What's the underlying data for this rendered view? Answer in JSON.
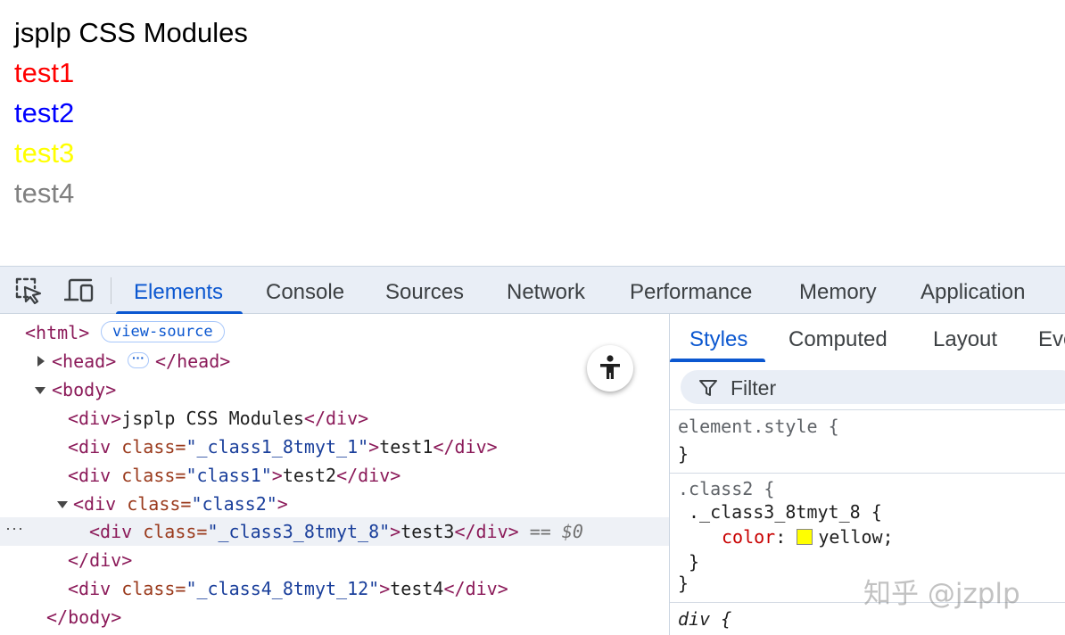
{
  "preview": {
    "lines": [
      {
        "text": "jsplp CSS Modules",
        "color": "#000000"
      },
      {
        "text": "test1",
        "color": "#ff0000"
      },
      {
        "text": "test2",
        "color": "#0000ff"
      },
      {
        "text": "test3",
        "color": "#ffff00"
      },
      {
        "text": "test4",
        "color": "#808080"
      }
    ]
  },
  "toolbar": {
    "icons": [
      "inspect-element-icon",
      "device-toolbar-icon"
    ],
    "tabs": [
      "Elements",
      "Console",
      "Sources",
      "Network",
      "Performance",
      "Memory",
      "Application"
    ],
    "active_tab": "Elements"
  },
  "elements": {
    "view_source_badge": "view-source",
    "selected_marker": "== $0",
    "gutter": "···",
    "rows": {
      "html_open": "<html>",
      "head_open": "<head>",
      "head_close": "</head>",
      "body_open": "<body>",
      "div1_open": "<div>",
      "div1_text": "jsplp CSS Modules",
      "div_close": "</div>",
      "div_open_attr": "<div",
      "class_attr": "class=",
      "div2_class": "\"_class1_8tmyt_1\"",
      "div2_text": "test1",
      "div3_class": "\"class1\"",
      "div3_text": "test2",
      "div4_class": "\"class2\"",
      "div5_class": "\"_class3_8tmyt_8\"",
      "div5_text": "test3",
      "div6_class": "\"_class4_8tmyt_12\"",
      "div6_text": "test4",
      "body_close": "</body>",
      "gt": ">"
    }
  },
  "styles": {
    "tabs": [
      "Styles",
      "Computed",
      "Layout",
      "Eve"
    ],
    "active_tab": "Styles",
    "filter_placeholder": "Filter",
    "element_style": "element.style {",
    "close_brace": "}",
    "outer_selector": ".class2 {",
    "inner_selector": "._class3_8tmyt_8 {",
    "prop": "color",
    "colon": ":",
    "value": "yellow;",
    "swatch_color": "#ffff00",
    "next_selector": "div {"
  },
  "watermark": "知乎 @jzplp"
}
